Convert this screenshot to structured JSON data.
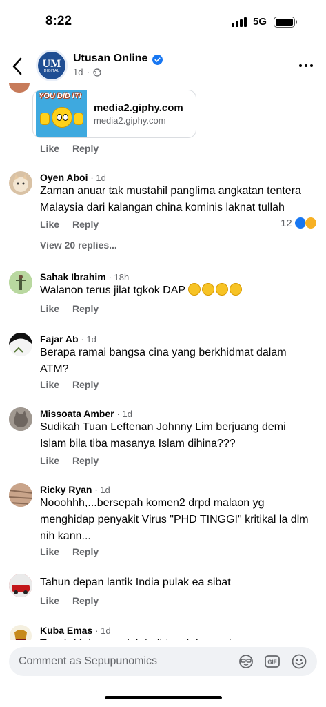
{
  "status_bar": {
    "time": "8:22",
    "network": "5G"
  },
  "header": {
    "page_name": "Utusan Online",
    "avatar_text": "UM",
    "avatar_subtext": "DIGITAL",
    "meta_time": "1d"
  },
  "link_card": {
    "gif_caption": "YOU DID IT!",
    "title": "media2.giphy.com",
    "domain": "media2.giphy.com"
  },
  "actions": {
    "like": "Like",
    "reply": "Reply"
  },
  "comments": [
    {
      "name": "Oyen Aboi",
      "time": "1d",
      "text": "Zaman anuar tak mustahil panglima angkatan tentera Malaysia dari kalangan china kominis laknat tullah",
      "reaction_count": "12",
      "replies": "View 20 replies..."
    },
    {
      "name": "Sahak Ibrahim",
      "time": "18h",
      "text": "Walanon terus jilat tgkok DAP"
    },
    {
      "name": "Fajar Ab",
      "time": "1d",
      "text": "Berapa ramai bangsa cina yang berkhidmat dalam ATM?"
    },
    {
      "name": "Missoata Amber",
      "time": "1d",
      "text": "Sudikah Tuan Leftenan Johnny Lim berjuang demi Islam bila tiba masanya Islam dihina???"
    },
    {
      "name": "Ricky Ryan",
      "time": "1d",
      "text": "Nooohhh,...bersepah komen2 drpd malaon yg menghidap penyakit Virus \"PHD TINGGI\" kritikal la dlm nih kann..."
    },
    {
      "name": "",
      "time": "",
      "text": "Tahun depan lantik India pulak ea sibat"
    },
    {
      "name": "Kuba Emas",
      "time": "1d",
      "text": "Tanah Melayu sudah jadi tanah komunis"
    }
  ],
  "composer": {
    "placeholder": "Comment as Sepupunomics"
  },
  "colors": {
    "accent": "#1877f2",
    "meta_gray": "#65676b"
  }
}
